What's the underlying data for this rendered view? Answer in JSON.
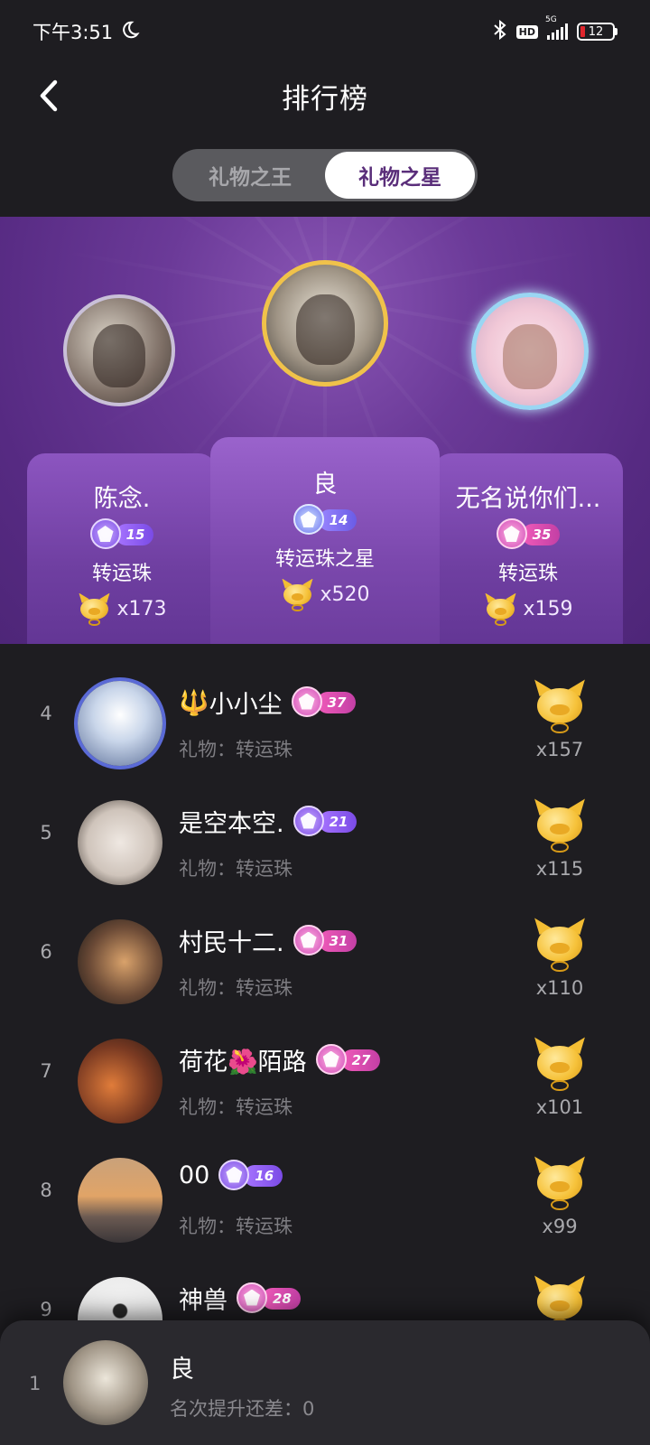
{
  "status_bar": {
    "time": "下午3:51",
    "hd": "HD",
    "network": "5G",
    "battery": "12"
  },
  "header": {
    "title": "排行榜"
  },
  "tabs": [
    {
      "label": "礼物之王",
      "active": false
    },
    {
      "label": "礼物之星",
      "active": true
    }
  ],
  "podium": {
    "first": {
      "name": "良",
      "level": "14",
      "level_style": "blue",
      "gift": "转运珠之星",
      "count": "x520"
    },
    "second": {
      "name": "陈念.",
      "level": "15",
      "level_style": "purple",
      "gift": "转运珠",
      "count": "x173"
    },
    "third": {
      "name": "无名说你们...",
      "level": "35",
      "level_style": "pink",
      "gift": "转运珠",
      "count": "x159"
    }
  },
  "list": [
    {
      "rank": "4",
      "prefix": "🔱",
      "name": "小小尘",
      "level": "37",
      "level_style": "pink",
      "gift": "礼物：转运珠",
      "count": "x157"
    },
    {
      "rank": "5",
      "prefix": "",
      "name": "是空本空.",
      "level": "21",
      "level_style": "purple",
      "gift": "礼物：转运珠",
      "count": "x115"
    },
    {
      "rank": "6",
      "prefix": "",
      "name": "村民十二.",
      "level": "31",
      "level_style": "pink",
      "gift": "礼物：转运珠",
      "count": "x110"
    },
    {
      "rank": "7",
      "prefix": "",
      "name": "荷花🌺陌路",
      "level": "27",
      "level_style": "pink",
      "gift": "礼物：转运珠",
      "count": "x101"
    },
    {
      "rank": "8",
      "prefix": "",
      "name": "00",
      "level": "16",
      "level_style": "purple",
      "gift": "礼物：转运珠",
      "count": "x99"
    },
    {
      "rank": "9",
      "prefix": "",
      "name": "神兽",
      "level": "28",
      "level_style": "pink",
      "gift": "",
      "count": ""
    }
  ],
  "self": {
    "rank": "1",
    "name": "良",
    "sub": "名次提升还差：0"
  }
}
